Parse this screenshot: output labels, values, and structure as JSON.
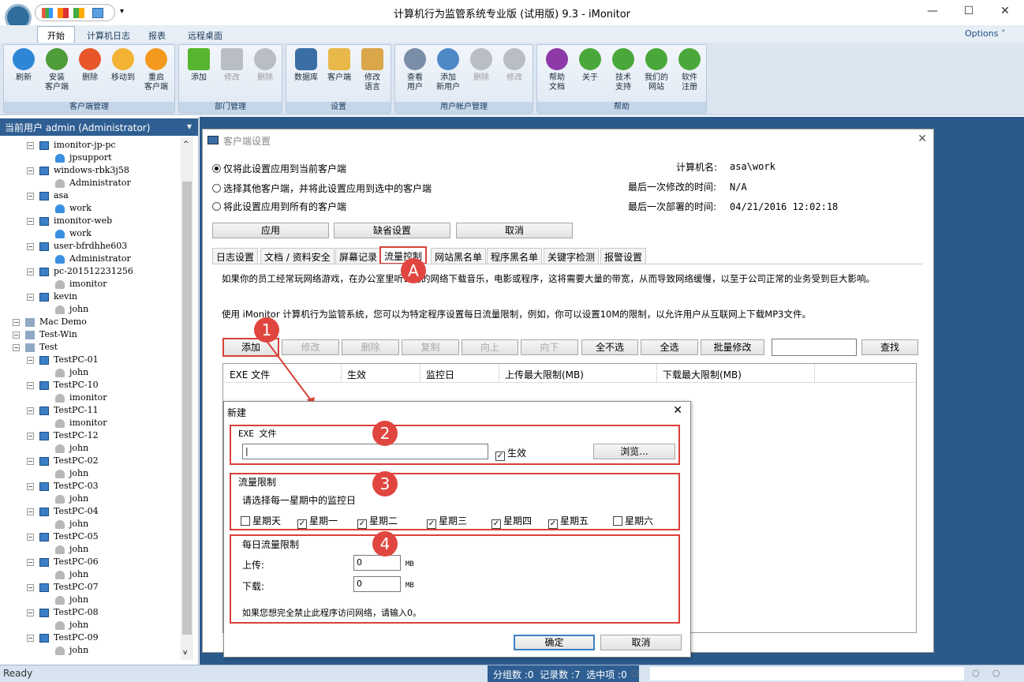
{
  "window": {
    "title": "计算机行为监管系统专业版 (试用版) 9.3 - iMonitor"
  },
  "tabs": [
    "开始",
    "计算机日志",
    "报表",
    "远程桌面"
  ],
  "options_label": "Options ˅",
  "ribbon": {
    "client": {
      "label": "客户端管理",
      "buttons": [
        "刷新",
        "安装\n客户端",
        "删除",
        "移动到",
        "重启\n客户端"
      ]
    },
    "dept": {
      "label": "部门管理",
      "buttons": [
        "添加",
        "修改",
        "删除"
      ]
    },
    "settings": {
      "label": "设置",
      "buttons": [
        "数据库",
        "客户端",
        "修改\n语言"
      ]
    },
    "account": {
      "label": "用户帐户管理",
      "buttons": [
        "查看\n用户",
        "添加\n新用户",
        "删除",
        "修改"
      ]
    },
    "help": {
      "label": "帮助",
      "buttons": [
        "帮助\n文档",
        "关于",
        "技术\n支持",
        "我们的\n网站",
        "软件\n注册"
      ]
    }
  },
  "current_user": "当前用户 admin (Administrator)",
  "tree": [
    {
      "label": "imonitor-jp-pc",
      "type": "pc",
      "level": 1
    },
    {
      "label": "jpsupport",
      "type": "user",
      "level": 2
    },
    {
      "label": "windows-rbk3j58",
      "type": "pc",
      "level": 1
    },
    {
      "label": "Administrator",
      "type": "user-off",
      "level": 2
    },
    {
      "label": "asa",
      "type": "pc",
      "level": 1
    },
    {
      "label": "work",
      "type": "user",
      "level": 2
    },
    {
      "label": "imonitor-web",
      "type": "pc",
      "level": 1
    },
    {
      "label": "work",
      "type": "user",
      "level": 2
    },
    {
      "label": "user-bfrdhhe603",
      "type": "pc",
      "level": 1
    },
    {
      "label": "Administrator",
      "type": "user",
      "level": 2
    },
    {
      "label": "pc-201512231256",
      "type": "pc",
      "level": 1
    },
    {
      "label": "imonitor",
      "type": "user-off",
      "level": 2
    },
    {
      "label": "kevin",
      "type": "pc",
      "level": 1
    },
    {
      "label": "john",
      "type": "user-off",
      "level": 2
    },
    {
      "label": "Mac Demo",
      "type": "group",
      "level": 0
    },
    {
      "label": "Test-Win",
      "type": "group",
      "level": 0
    },
    {
      "label": "Test",
      "type": "group",
      "level": 0
    },
    {
      "label": "TestPC-01",
      "type": "pc",
      "level": 1
    },
    {
      "label": "john",
      "type": "user-off",
      "level": 2
    },
    {
      "label": "TestPC-10",
      "type": "pc",
      "level": 1
    },
    {
      "label": "imonitor",
      "type": "user-off",
      "level": 2
    },
    {
      "label": "TestPC-11",
      "type": "pc",
      "level": 1
    },
    {
      "label": "imonitor",
      "type": "user-off",
      "level": 2
    },
    {
      "label": "TestPC-12",
      "type": "pc",
      "level": 1
    },
    {
      "label": "john",
      "type": "user-off",
      "level": 2
    },
    {
      "label": "TestPC-02",
      "type": "pc",
      "level": 1
    },
    {
      "label": "john",
      "type": "user-off",
      "level": 2
    },
    {
      "label": "TestPC-03",
      "type": "pc",
      "level": 1
    },
    {
      "label": "john",
      "type": "user-off",
      "level": 2
    },
    {
      "label": "TestPC-04",
      "type": "pc",
      "level": 1
    },
    {
      "label": "john",
      "type": "user-off",
      "level": 2
    },
    {
      "label": "TestPC-05",
      "type": "pc",
      "level": 1
    },
    {
      "label": "john",
      "type": "user-off",
      "level": 2
    },
    {
      "label": "TestPC-06",
      "type": "pc",
      "level": 1
    },
    {
      "label": "john",
      "type": "user-off",
      "level": 2
    },
    {
      "label": "TestPC-07",
      "type": "pc",
      "level": 1
    },
    {
      "label": "john",
      "type": "user-off",
      "level": 2
    },
    {
      "label": "TestPC-08",
      "type": "pc",
      "level": 1
    },
    {
      "label": "john",
      "type": "user-off",
      "level": 2
    },
    {
      "label": "TestPC-09",
      "type": "pc",
      "level": 1
    },
    {
      "label": "john",
      "type": "user-off",
      "level": 2
    }
  ],
  "client_settings": {
    "title": "客户端设置",
    "radio1": "仅将此设置应用到当前客户端",
    "radio2": "选择其他客户端，并将此设置应用到选中的客户端",
    "radio3": "将此设置应用到所有的客户端",
    "computer_name_label": "计算机名:",
    "computer_name": "asa\\work",
    "last_modified_label": "最后一次修改的时间:",
    "last_modified": "N/A",
    "last_deployed_label": "最后一次部署的时间:",
    "last_deployed": "04/21/2016 12:02:18",
    "apply": "应用",
    "defaults": "缺省设置",
    "cancel": "取消",
    "tabs": [
      "日志设置",
      "文档 / 资料安全",
      "屏幕记录",
      "流量控制",
      "网站黑名单",
      "程序黑名单",
      "关键字检测",
      "报警设置"
    ],
    "desc1": "如果你的员工经常玩网络游戏，在办公室里听公司的网络下载音乐，电影或程序，这将需要大量的带宽，从而导致网络缓慢，以至于公司正常的业务受到巨大影响。",
    "desc2": "使用 iMonitor 计算机行为监管系统，您可以为特定程序设置每日流量限制，例如，你可以设置10M的限制，以允许用户从互联网上下载MP3文件。",
    "toolbar": [
      "添加",
      "修改",
      "删除",
      "复制",
      "向上",
      "向下",
      "全不选",
      "全选",
      "批量修改"
    ],
    "find": "查找",
    "columns": [
      "EXE 文件",
      "生效",
      "监控日",
      "上传最大限制(MB)",
      "下载最大限制(MB)"
    ]
  },
  "badges": {
    "a": "A",
    "n1": "1",
    "n2": "2",
    "n3": "3",
    "n4": "4"
  },
  "new_dialog": {
    "title": "新建",
    "exe_label": "EXE 文件",
    "enabled": "生效",
    "browse": "浏览...",
    "traffic_label": "流量限制",
    "select_days": "请选择每一星期中的监控日",
    "days": [
      {
        "label": "星期天",
        "checked": false
      },
      {
        "label": "星期一",
        "checked": true
      },
      {
        "label": "星期二",
        "checked": true
      },
      {
        "label": "星期三",
        "checked": true
      },
      {
        "label": "星期四",
        "checked": true
      },
      {
        "label": "星期五",
        "checked": true
      },
      {
        "label": "星期六",
        "checked": false
      }
    ],
    "daily_label": "每日流量限制",
    "upload_label": "上传:",
    "upload_value": "0",
    "download_label": "下载:",
    "download_value": "0",
    "unit": "MB",
    "hint": "如果您想完全禁止此程序访问网络，请输入0。",
    "ok": "确定",
    "cancel": "取消"
  },
  "status": {
    "ready": "Ready",
    "counts": "分组数 :0  记录数 :7  选中项 :0"
  }
}
